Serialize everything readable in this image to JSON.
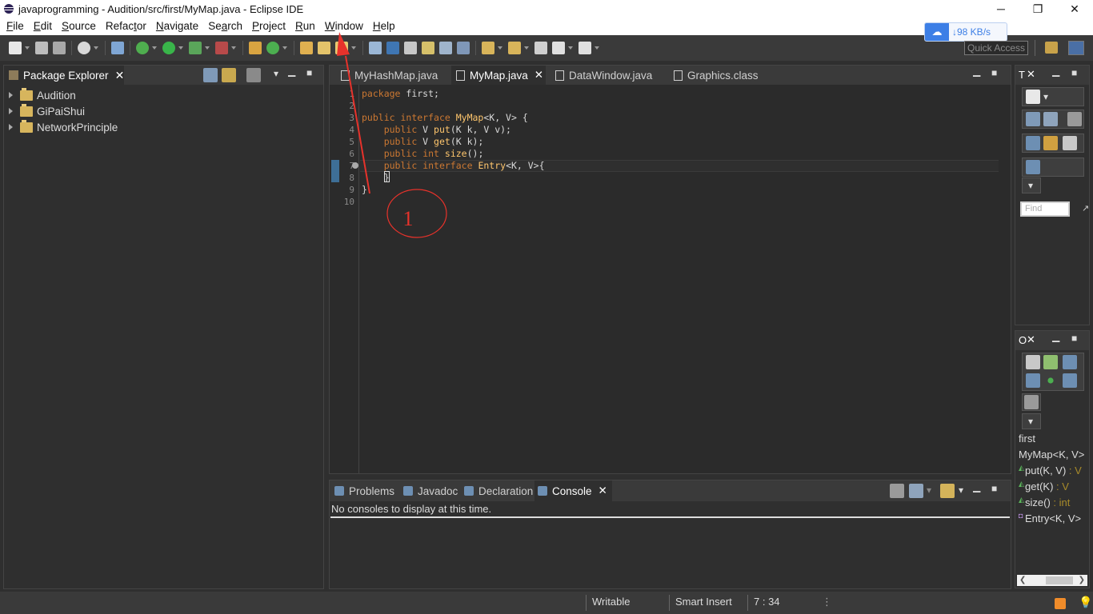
{
  "window": {
    "title": "javaprogramming - Audition/src/first/MyMap.java - Eclipse IDE",
    "minimize": "─",
    "maximize": "❐",
    "close": "✕"
  },
  "menu": [
    {
      "pre": "",
      "ul": "F",
      "post": "ile"
    },
    {
      "pre": "",
      "ul": "E",
      "post": "dit"
    },
    {
      "pre": "",
      "ul": "S",
      "post": "ource"
    },
    {
      "pre": "Refac",
      "ul": "t",
      "post": "or"
    },
    {
      "pre": "",
      "ul": "N",
      "post": "avigate"
    },
    {
      "pre": "Se",
      "ul": "a",
      "post": "rch"
    },
    {
      "pre": "",
      "ul": "P",
      "post": "roject"
    },
    {
      "pre": "",
      "ul": "R",
      "post": "un"
    },
    {
      "pre": "",
      "ul": "W",
      "post": "indow"
    },
    {
      "pre": "",
      "ul": "H",
      "post": "elp"
    }
  ],
  "netspeed": {
    "text": "98 KB/s",
    "arrow": "↓"
  },
  "quick_access": {
    "placeholder": "Quick Access"
  },
  "package_explorer": {
    "title": "Package Explorer",
    "projects": [
      "Audition",
      "GiPaiShui",
      "NetworkPrinciple"
    ]
  },
  "editor": {
    "tabs": [
      {
        "label": "MyHashMap.java",
        "active": false
      },
      {
        "label": "MyMap.java",
        "active": true
      },
      {
        "label": "DataWindow.java",
        "active": false
      },
      {
        "label": "Graphics.class",
        "active": false
      }
    ],
    "line_numbers": [
      "1",
      "2",
      "3",
      "4",
      "5",
      "6",
      "7",
      "8",
      "9",
      "10"
    ],
    "lines": [
      [
        {
          "t": "package",
          "c": "kw"
        },
        {
          "t": " first;",
          "c": "nm"
        }
      ],
      [],
      [
        {
          "t": "public",
          "c": "kw"
        },
        {
          "t": " ",
          "c": "nm"
        },
        {
          "t": "interface",
          "c": "kw"
        },
        {
          "t": " ",
          "c": "nm"
        },
        {
          "t": "MyMap",
          "c": "ty"
        },
        {
          "t": "<K, V> {",
          "c": "nm"
        }
      ],
      [
        {
          "t": "    ",
          "c": "nm"
        },
        {
          "t": "public",
          "c": "kw"
        },
        {
          "t": " V ",
          "c": "nm"
        },
        {
          "t": "put",
          "c": "ty"
        },
        {
          "t": "(K k, V v);",
          "c": "nm"
        }
      ],
      [
        {
          "t": "    ",
          "c": "nm"
        },
        {
          "t": "public",
          "c": "kw"
        },
        {
          "t": " V ",
          "c": "nm"
        },
        {
          "t": "get",
          "c": "ty"
        },
        {
          "t": "(K k);",
          "c": "nm"
        }
      ],
      [
        {
          "t": "    ",
          "c": "nm"
        },
        {
          "t": "public",
          "c": "kw"
        },
        {
          "t": " ",
          "c": "nm"
        },
        {
          "t": "int",
          "c": "kw"
        },
        {
          "t": " ",
          "c": "nm"
        },
        {
          "t": "size",
          "c": "ty"
        },
        {
          "t": "();",
          "c": "nm"
        }
      ],
      [
        {
          "t": "    ",
          "c": "nm"
        },
        {
          "t": "public",
          "c": "kw"
        },
        {
          "t": " ",
          "c": "nm"
        },
        {
          "t": "interface",
          "c": "kw"
        },
        {
          "t": " ",
          "c": "nm"
        },
        {
          "t": "Entry",
          "c": "ty"
        },
        {
          "t": "<K, V>{",
          "c": "nm"
        }
      ],
      [
        {
          "t": "    }",
          "c": "nm"
        }
      ],
      [
        {
          "t": "}",
          "c": "nm"
        }
      ],
      []
    ]
  },
  "bottom_panel": {
    "tabs": [
      {
        "label": "Problems",
        "active": false
      },
      {
        "label": "Javadoc",
        "active": false
      },
      {
        "label": "Declaration",
        "active": false
      },
      {
        "label": "Console",
        "active": true
      }
    ],
    "console_message": "No consoles to display at this time."
  },
  "right_top": {
    "tab": "T",
    "find_placeholder": "Find"
  },
  "outline": {
    "tab": "O",
    "items": [
      {
        "name": "first",
        "ret": ""
      },
      {
        "name": "MyMap<K, V>",
        "ret": ""
      },
      {
        "name": "put(K, V)",
        "ret": " : V"
      },
      {
        "name": "get(K)",
        "ret": " : V"
      },
      {
        "name": "size()",
        "ret": " : int"
      },
      {
        "name": "Entry<K, V>",
        "ret": ""
      }
    ]
  },
  "status": {
    "writable": "Writable",
    "insert_mode": "Smart Insert",
    "position": "7 : 34"
  },
  "annotation": {
    "label": "1",
    "color": "#e8322b"
  }
}
